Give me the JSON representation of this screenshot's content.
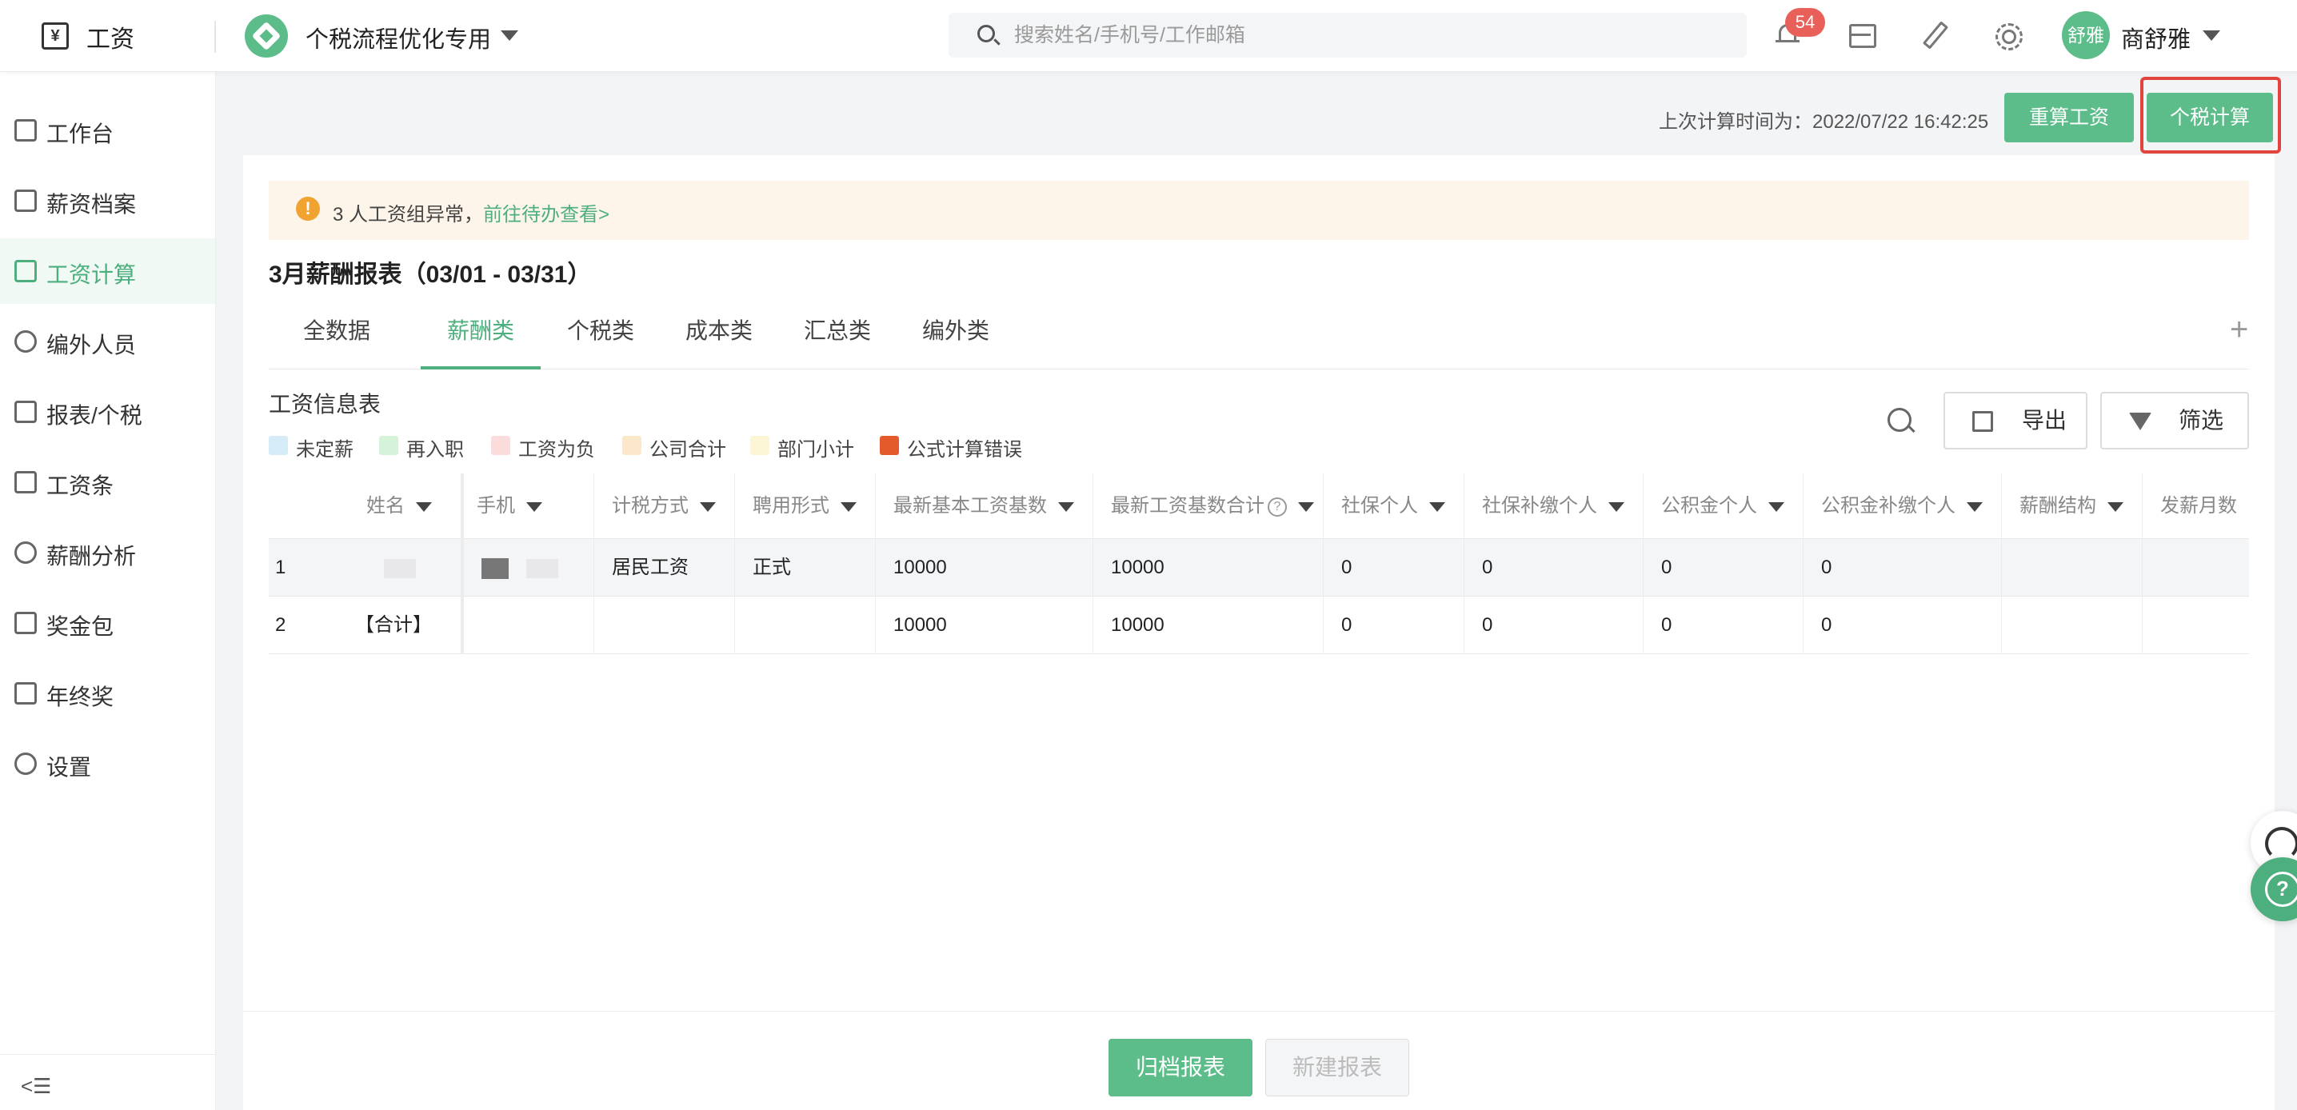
{
  "topbar": {
    "app_icon_glyph": "¥",
    "app_title": "工资",
    "company_name": "个税流程优化专用",
    "search_placeholder": "搜索姓名/手机号/工作邮箱",
    "notification_count": "54",
    "avatar_text": "舒雅",
    "user_name": "商舒雅"
  },
  "sidebar": {
    "items": [
      {
        "label": "工作台",
        "icon": "dashboard-icon"
      },
      {
        "label": "薪资档案",
        "icon": "profile-icon"
      },
      {
        "label": "工资计算",
        "icon": "calendar-icon"
      },
      {
        "label": "编外人员",
        "icon": "people-icon"
      },
      {
        "label": "报表/个税",
        "icon": "bar-chart-icon"
      },
      {
        "label": "工资条",
        "icon": "document-icon"
      },
      {
        "label": "薪酬分析",
        "icon": "person-icon"
      },
      {
        "label": "奖金包",
        "icon": "folder-icon"
      },
      {
        "label": "年终奖",
        "icon": "calendar-check-icon"
      },
      {
        "label": "设置",
        "icon": "gear-icon"
      }
    ],
    "active_item": "工资计算",
    "collapse_glyph": "<☰"
  },
  "header": {
    "last_calc": "上次计算时间为：2022/07/22 16:42:25",
    "recalc_label": "重算工资",
    "tax_calc_label": "个税计算"
  },
  "alert": {
    "icon_glyph": "!",
    "text": "3 人工资组异常，",
    "link": "前往待办查看>"
  },
  "report": {
    "title": "3月薪酬报表（03/01 - 03/31）",
    "tabs": [
      "全数据",
      "薪酬类",
      "个税类",
      "成本类",
      "汇总类",
      "编外类"
    ],
    "active_tab": "薪酬类",
    "add_glyph": "+"
  },
  "table_section": {
    "name": "工资信息表",
    "legend": [
      {
        "label": "未定薪",
        "color": "#d6ebf8"
      },
      {
        "label": "再入职",
        "color": "#d4f3d8"
      },
      {
        "label": "工资为负",
        "color": "#fadcdc"
      },
      {
        "label": "公司合计",
        "color": "#fbe7c9"
      },
      {
        "label": "部门小计",
        "color": "#fcf6d6"
      },
      {
        "label": "公式计算错误",
        "color": "#e55a2b"
      }
    ],
    "export_label": "导出",
    "filter_label": "筛选"
  },
  "table": {
    "columns": [
      "姓名",
      "手机",
      "计税方式",
      "聘用形式",
      "最新基本工资基数",
      "最新工资基数合计",
      "社保个人",
      "社保补缴个人",
      "公积金个人",
      "公积金补缴个人",
      "薪酬结构",
      "发薪月数"
    ],
    "help_glyph": "?",
    "rows": [
      {
        "idx": "1",
        "name": "",
        "phone": "",
        "tax_method": "居民工资",
        "employment": "正式",
        "base_salary": "10000",
        "base_total": "10000",
        "social": "0",
        "social_back": "0",
        "fund": "0",
        "fund_back": "0",
        "structure": "",
        "months": ""
      },
      {
        "idx": "2",
        "name": "【合计】",
        "phone": "",
        "tax_method": "",
        "employment": "",
        "base_salary": "10000",
        "base_total": "10000",
        "social": "0",
        "social_back": "0",
        "fund": "0",
        "fund_back": "0",
        "structure": "",
        "months": ""
      }
    ]
  },
  "bottom": {
    "archive_label": "归档报表",
    "new_report_label": "新建报表"
  },
  "colors": {
    "accent": "#5cbd8a",
    "highlight": "#e0443c",
    "badge": "#e9605a"
  }
}
